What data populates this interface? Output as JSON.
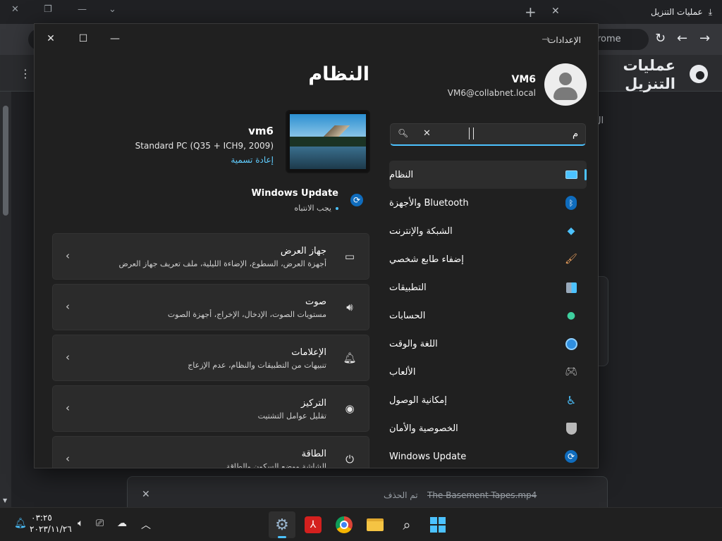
{
  "chrome": {
    "tab_title": "عمليات التنزيل",
    "omnibox_text": "rome",
    "page_heading": "عمليات التنزيل",
    "side_label": "ال",
    "download": {
      "filename": "The Basement Tapes.mp4",
      "status": "تم الحذف"
    }
  },
  "settings": {
    "window_title": "الإعدادات",
    "user": {
      "name": "VM6",
      "email": "VM6@collabnet.local"
    },
    "search": {
      "value": "م"
    },
    "nav": [
      {
        "label": "النظام",
        "icon": "system-icon",
        "selected": true
      },
      {
        "label": "Bluetooth والأجهزة",
        "icon": "bluetooth-icon"
      },
      {
        "label": "الشبكة والإنترنت",
        "icon": "wifi-icon"
      },
      {
        "label": "إضفاء طابع شخصي",
        "icon": "brush-icon"
      },
      {
        "label": "التطبيقات",
        "icon": "apps-icon"
      },
      {
        "label": "الحسابات",
        "icon": "account-icon"
      },
      {
        "label": "اللغة والوقت",
        "icon": "globe-clock-icon"
      },
      {
        "label": "الألعاب",
        "icon": "gamepad-icon"
      },
      {
        "label": "إمكانية الوصول",
        "icon": "accessibility-icon"
      },
      {
        "label": "الخصوصية والأمان",
        "icon": "shield-icon"
      },
      {
        "label": "Windows Update",
        "icon": "update-icon"
      }
    ],
    "page_title": "النظام",
    "device": {
      "name": "vm6",
      "model": "Standard PC (Q35 + ICH9, 2009)",
      "rename": "إعادة تسمية"
    },
    "windows_update": {
      "title": "Windows Update",
      "status": "يجب الانتباه"
    },
    "cards": [
      {
        "title": "جهاز العرض",
        "desc": "أجهزة العرض، السطوع، الإضاءة الليلية، ملف تعريف جهاز العرض",
        "icon": "monitor-icon"
      },
      {
        "title": "صوت",
        "desc": "مستويات الصوت، الإدخال، الإخراج، أجهزة الصوت",
        "icon": "speaker-icon"
      },
      {
        "title": "الإعلامات",
        "desc": "تنبيهات من التطبيقات والنظام، عدم الإزعاج",
        "icon": "bell-icon"
      },
      {
        "title": "التركيز",
        "desc": "تقليل عوامل التشتيت",
        "icon": "focus-icon"
      },
      {
        "title": "الطاقة",
        "desc": "الشاشة ووضع السكون والطاقة",
        "icon": "power-icon"
      }
    ]
  },
  "taskbar": {
    "time": "٠٣:٢٥",
    "date": "٢٠٢٣/١١/٢٦"
  }
}
